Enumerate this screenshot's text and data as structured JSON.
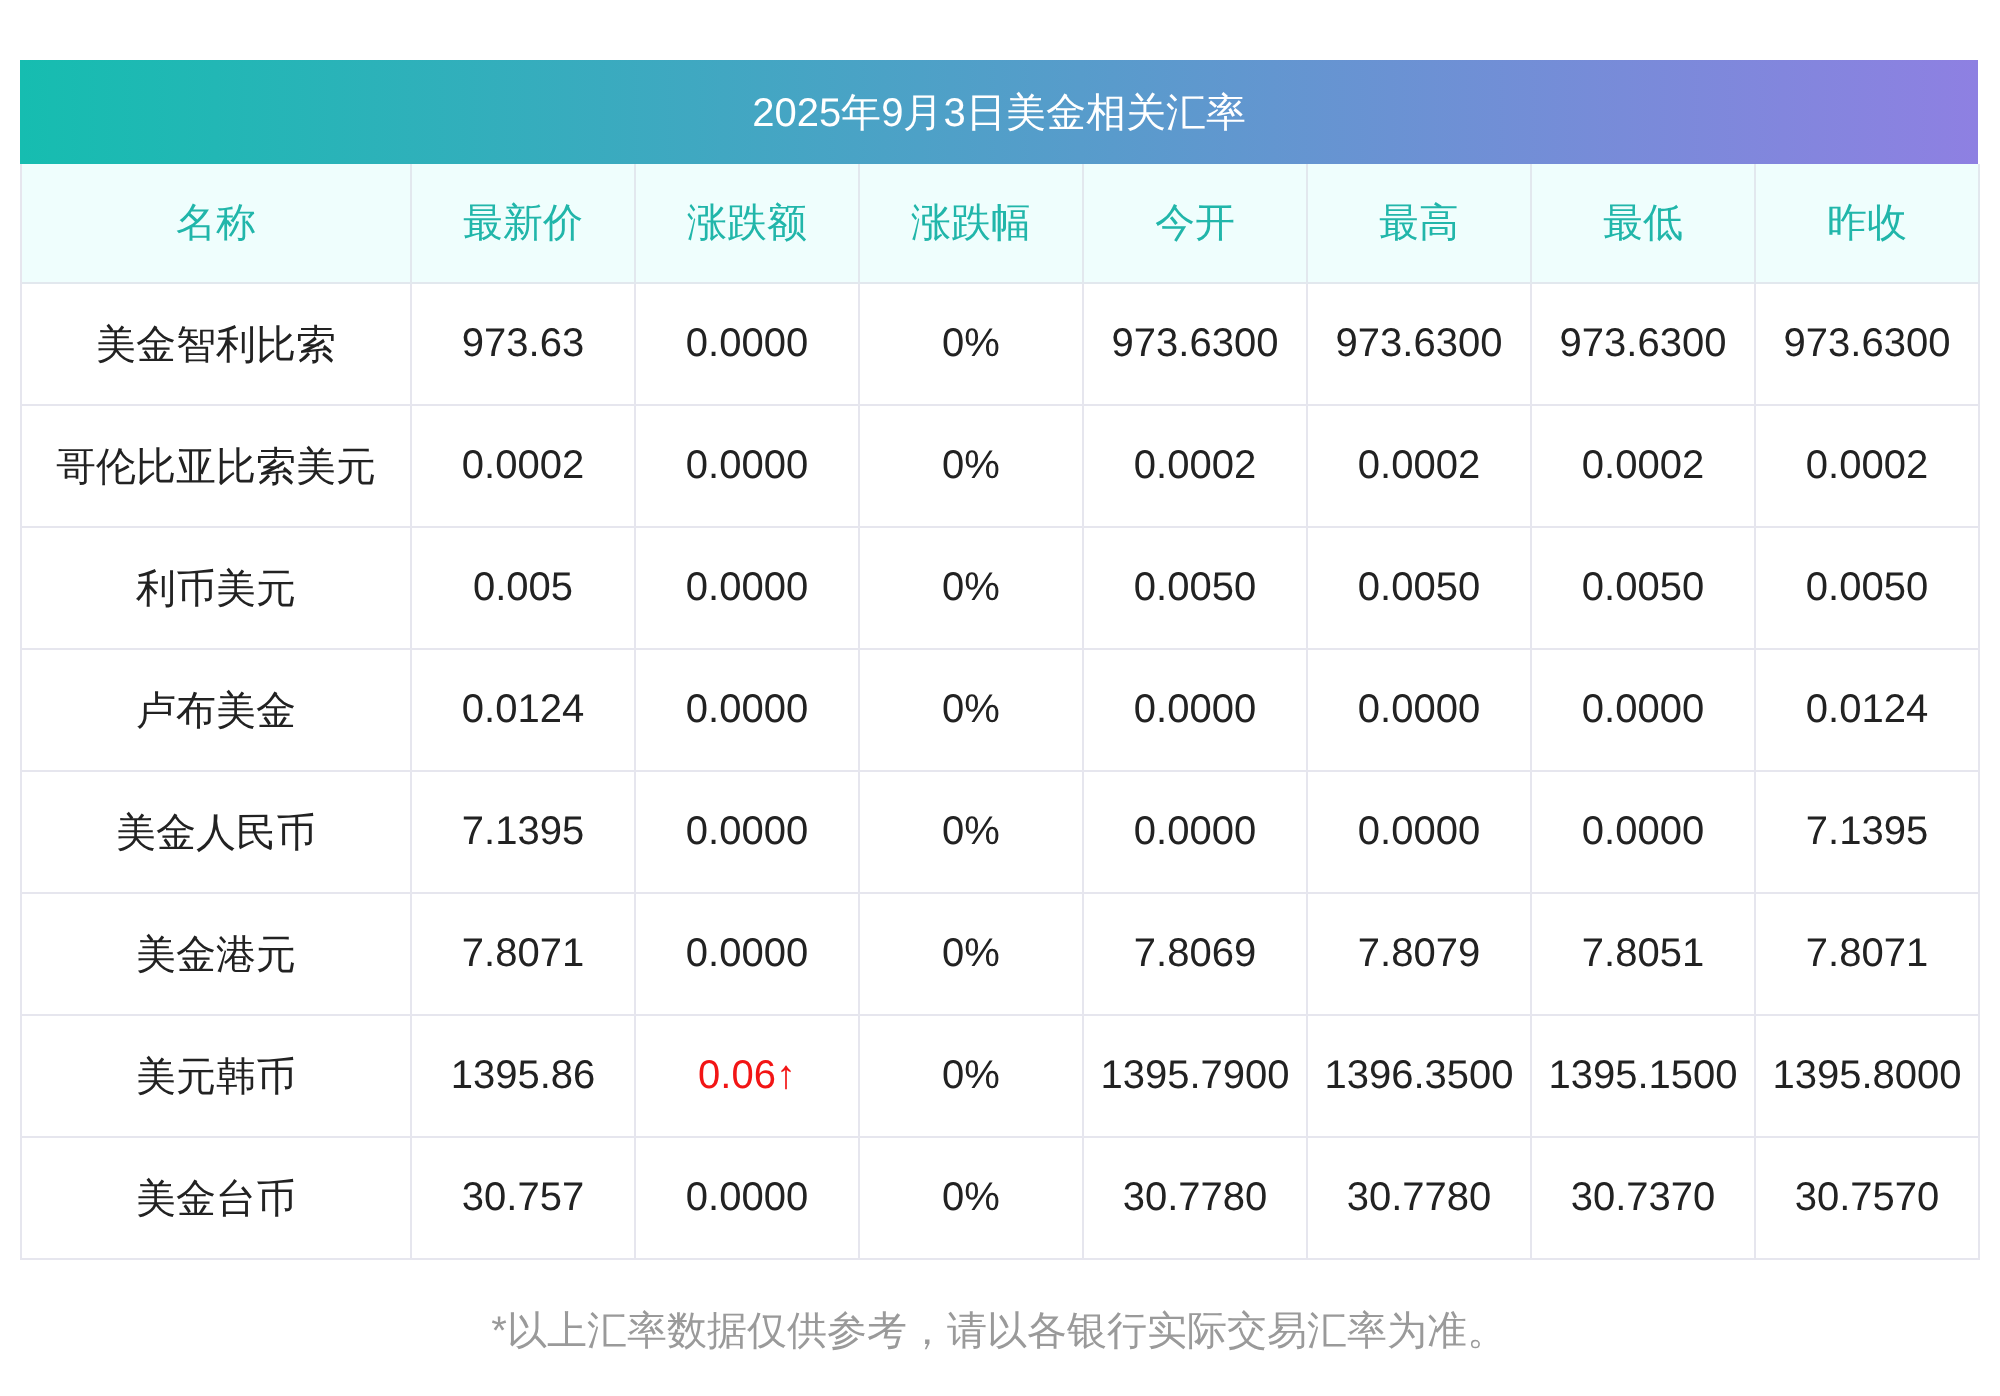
{
  "title": "2025年9月3日美金相关汇率",
  "columns": [
    "名称",
    "最新价",
    "涨跌额",
    "涨跌幅",
    "今开",
    "最高",
    "最低",
    "昨收"
  ],
  "rows": [
    {
      "cells": [
        "美金智利比索",
        "973.63",
        "0.0000",
        "0%",
        "973.6300",
        "973.6300",
        "973.6300",
        "973.6300"
      ],
      "change_up": false
    },
    {
      "cells": [
        "哥伦比亚比索美元",
        "0.0002",
        "0.0000",
        "0%",
        "0.0002",
        "0.0002",
        "0.0002",
        "0.0002"
      ],
      "change_up": false
    },
    {
      "cells": [
        "利币美元",
        "0.005",
        "0.0000",
        "0%",
        "0.0050",
        "0.0050",
        "0.0050",
        "0.0050"
      ],
      "change_up": false
    },
    {
      "cells": [
        "卢布美金",
        "0.0124",
        "0.0000",
        "0%",
        "0.0000",
        "0.0000",
        "0.0000",
        "0.0124"
      ],
      "change_up": false
    },
    {
      "cells": [
        "美金人民币",
        "7.1395",
        "0.0000",
        "0%",
        "0.0000",
        "0.0000",
        "0.0000",
        "7.1395"
      ],
      "change_up": false
    },
    {
      "cells": [
        "美金港元",
        "7.8071",
        "0.0000",
        "0%",
        "7.8069",
        "7.8079",
        "7.8051",
        "7.8071"
      ],
      "change_up": false
    },
    {
      "cells": [
        "美元韩币",
        "1395.86",
        "0.06↑",
        "0%",
        "1395.7900",
        "1396.3500",
        "1395.1500",
        "1395.8000"
      ],
      "change_up": true
    },
    {
      "cells": [
        "美金台币",
        "30.757",
        "0.0000",
        "0%",
        "30.7780",
        "30.7780",
        "30.7370",
        "30.7570"
      ],
      "change_up": false
    }
  ],
  "footnote": "*以上汇率数据仅供参考，请以各银行实际交易汇率为准。"
}
